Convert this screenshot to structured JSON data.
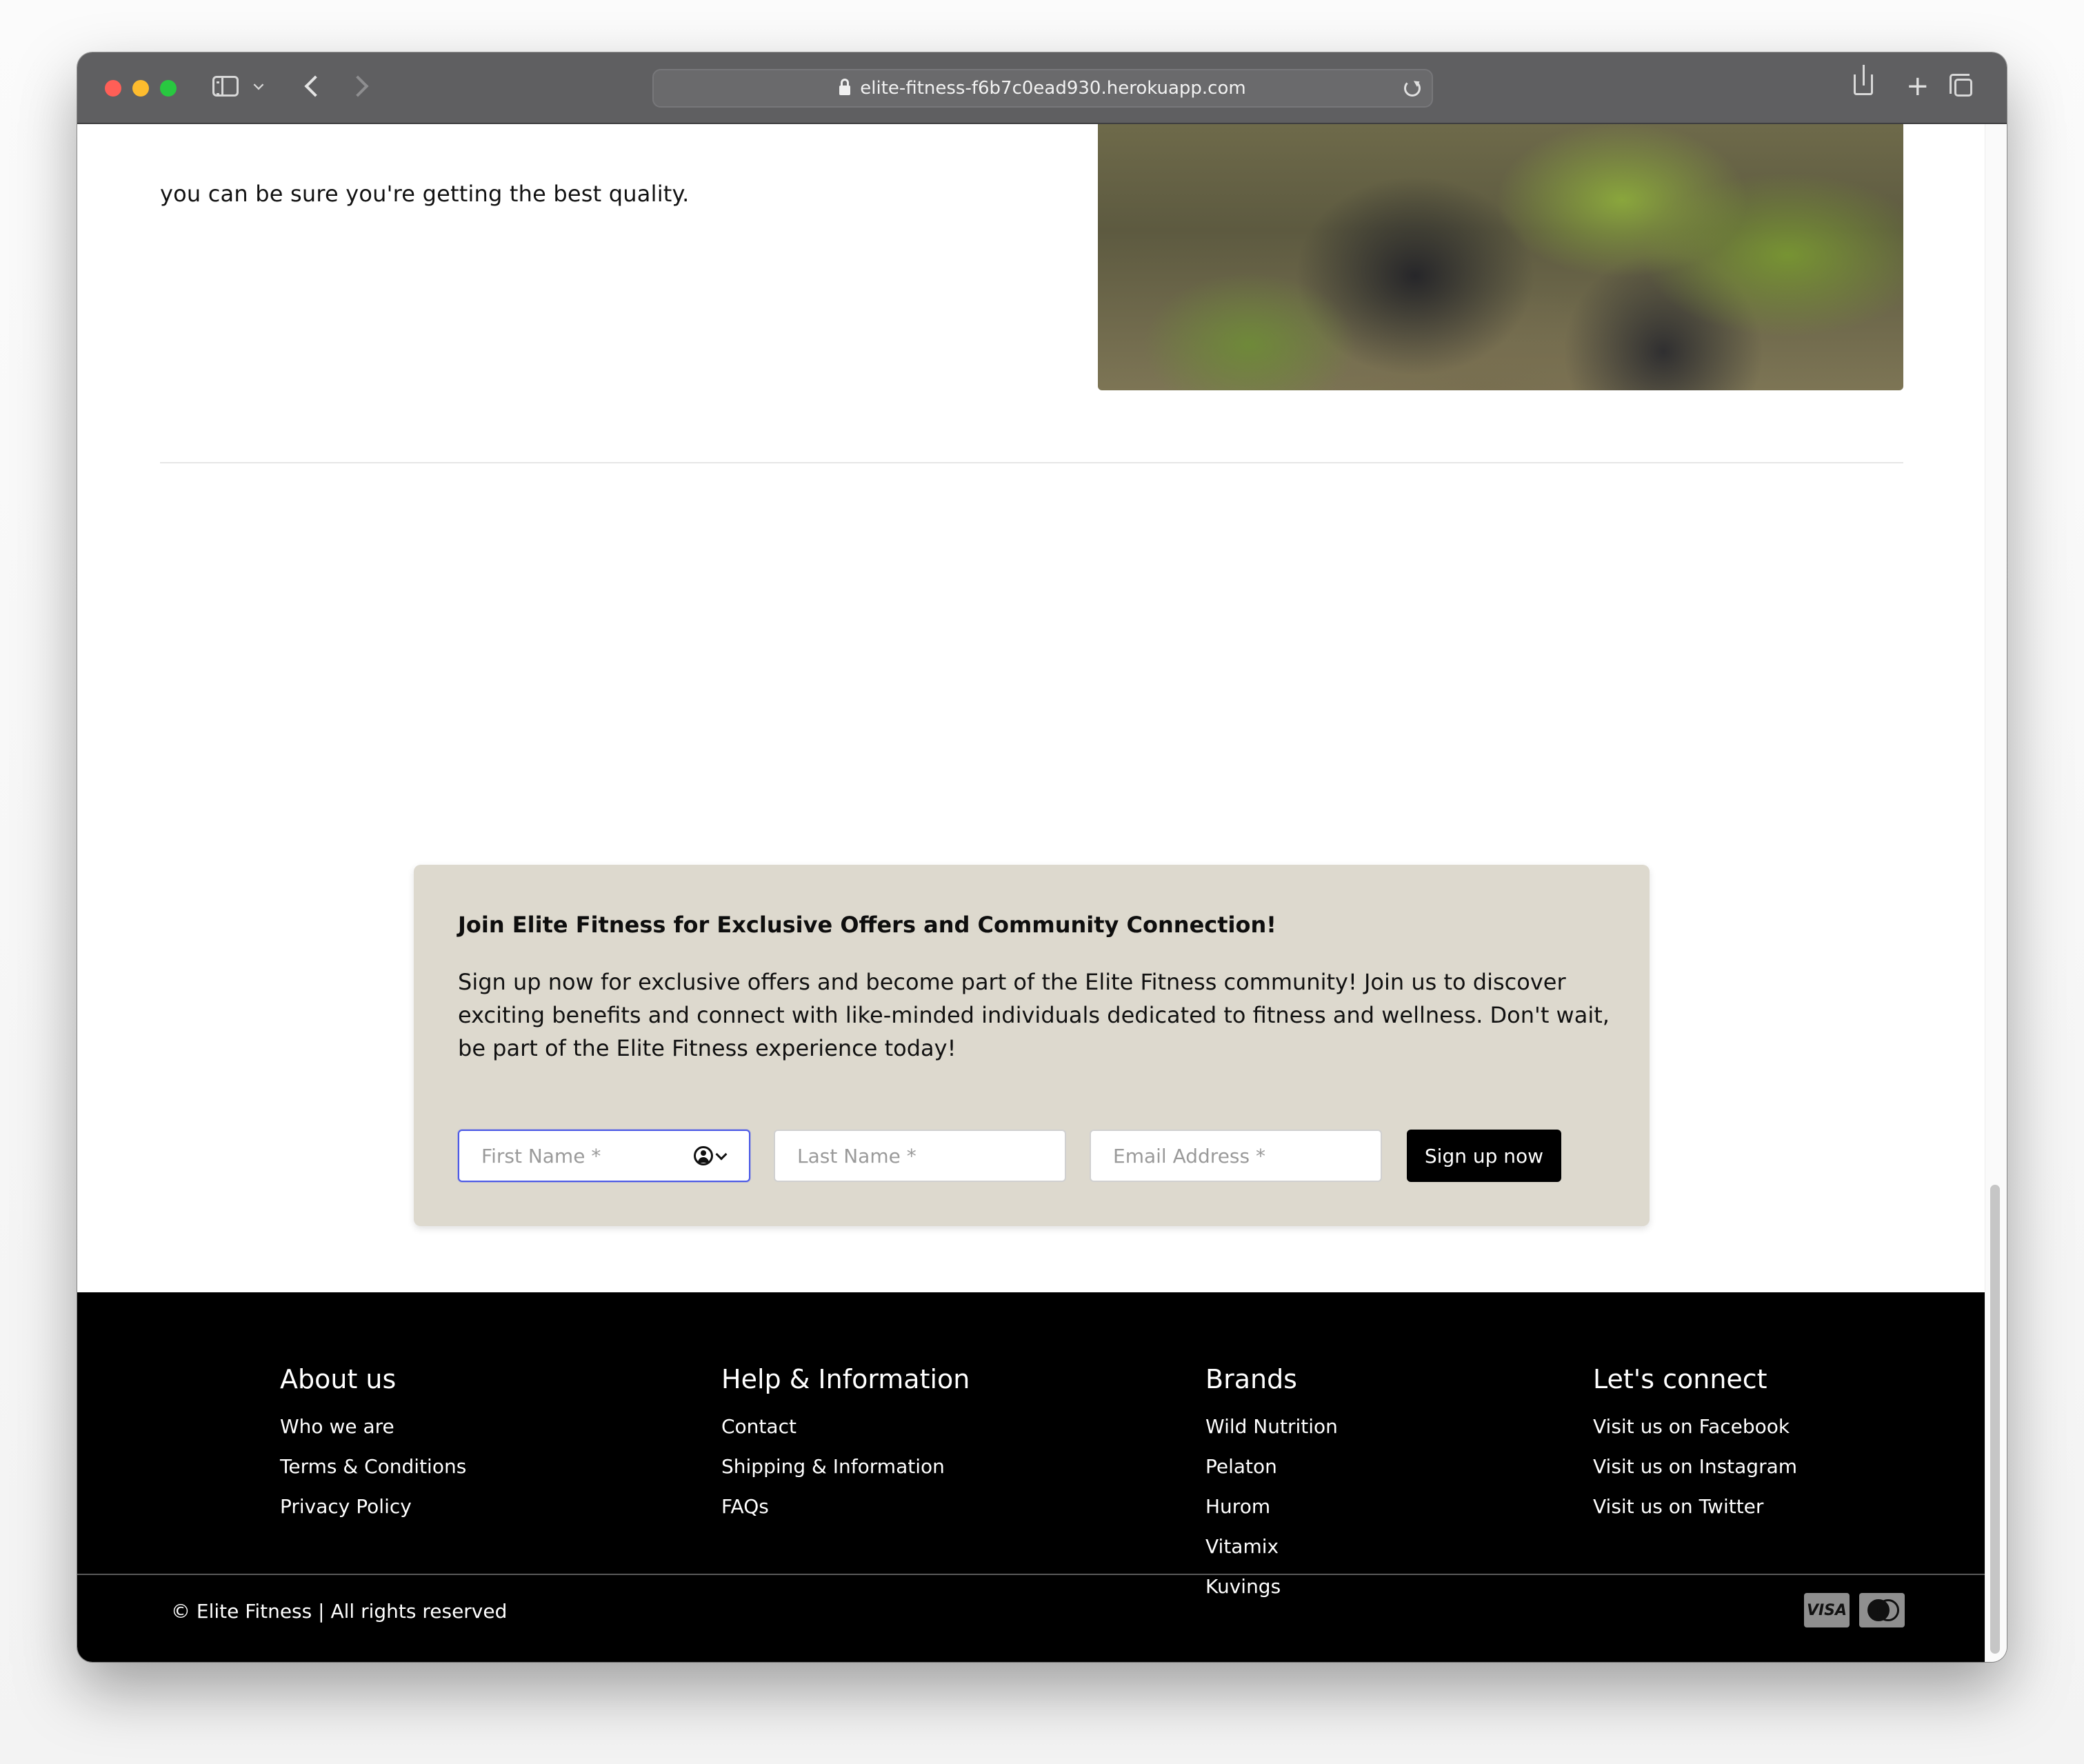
{
  "browser": {
    "url": "elite-fitness-f6b7c0ead930.herokuapp.com"
  },
  "intro": {
    "text": "you can be sure you're getting the best quality."
  },
  "signup": {
    "title": "Join Elite Fitness for Exclusive Offers and Community Connection!",
    "description": "Sign up now for exclusive offers and become part of the Elite Fitness community! Join us to discover exciting benefits and connect with like-minded individuals dedicated to fitness and wellness. Don't wait, be part of the Elite Fitness experience today!",
    "first_name_placeholder": "First Name *",
    "last_name_placeholder": "Last Name *",
    "email_placeholder": "Email Address *",
    "button_label": "Sign up now"
  },
  "footer": {
    "about": {
      "heading": "About us",
      "links": [
        "Who we are",
        "Terms & Conditions",
        "Privacy Policy"
      ]
    },
    "help": {
      "heading": "Help & Information",
      "links": [
        "Contact",
        "Shipping & Information",
        "FAQs"
      ]
    },
    "brands": {
      "heading": "Brands",
      "links": [
        "Wild Nutrition",
        "Pelaton",
        "Hurom",
        "Vitamix",
        "Kuvings"
      ]
    },
    "connect": {
      "heading": "Let's connect",
      "links": [
        "Visit us on Facebook",
        "Visit us on Instagram",
        "Visit us on Twitter"
      ]
    },
    "copyright": "© Elite Fitness | All rights reserved",
    "payment_visa": "VISA"
  },
  "icons": {
    "lock": "lock-icon",
    "reload": "reload-icon",
    "autofill": "contact-autofill-icon"
  },
  "colors": {
    "signup_bg": "#ddd9ce",
    "focus_border": "#4a58e6",
    "footer_bg": "#000000",
    "button_bg": "#000000"
  }
}
